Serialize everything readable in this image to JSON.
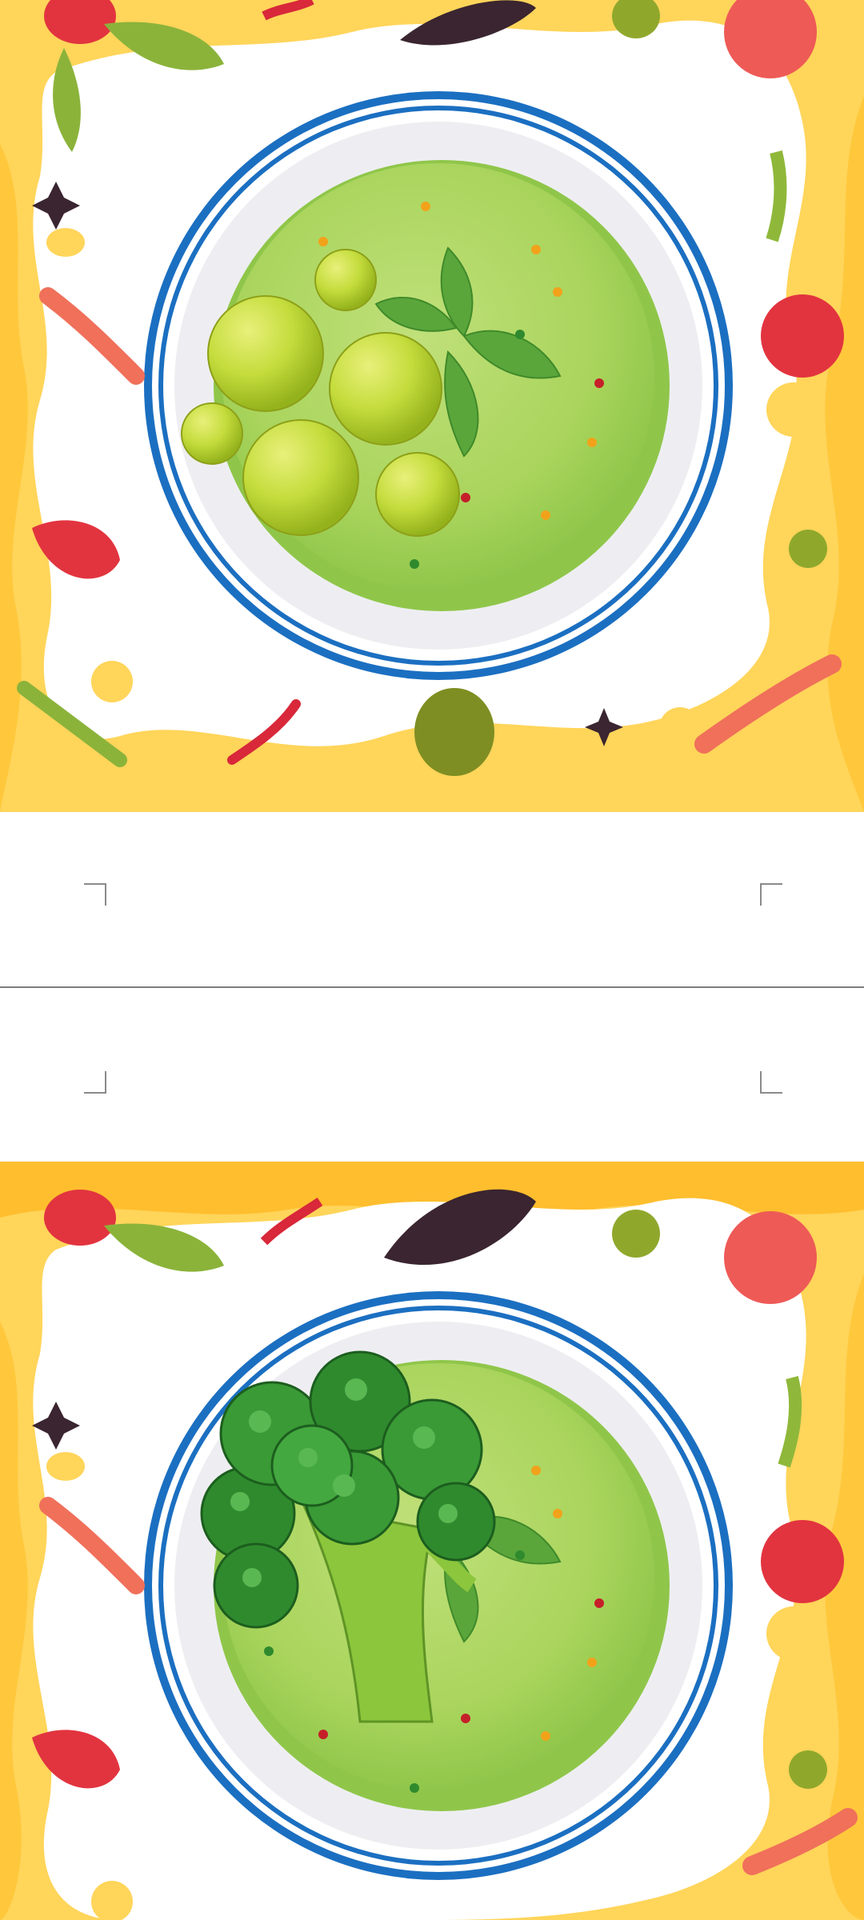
{
  "document": {
    "pages": [
      {
        "image": "soup-plate-illustration",
        "dish": "green-soup-with-peas",
        "colors": {
          "border_yellow": "#ffd55a",
          "border_orange": "#ffbe2e",
          "plate_rim_blue": "#1b6fc1",
          "soup_green": "#a9d45c",
          "pea_green": "#c4dc3c"
        }
      },
      {
        "image": "soup-plate-illustration",
        "dish": "green-soup-with-broccoli",
        "colors": {
          "border_yellow": "#ffd55a",
          "border_orange": "#ffbe2e",
          "plate_rim_blue": "#1b6fc1",
          "soup_green": "#a9d45c",
          "broccoli_green": "#2f8a2e"
        }
      }
    ],
    "page_break": {
      "corner_marks": [
        "crop-corner",
        "crop-corner",
        "crop-corner",
        "crop-corner"
      ]
    }
  }
}
